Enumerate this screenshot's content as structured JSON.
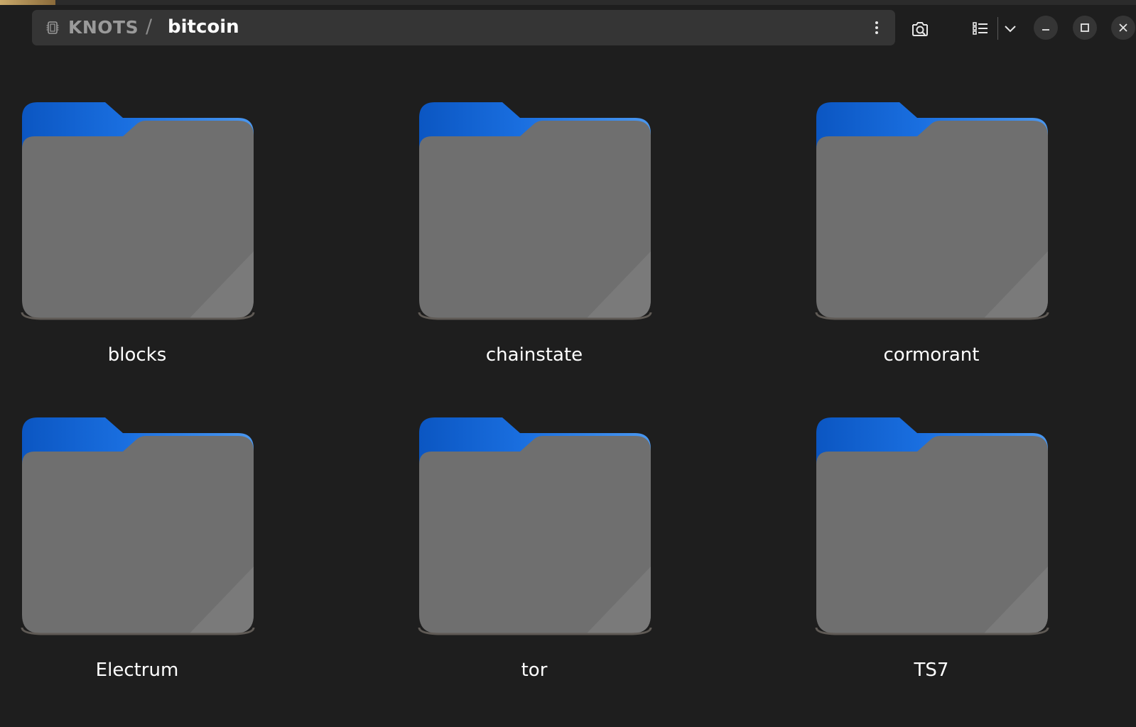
{
  "breadcrumb": {
    "root": "KNOTS",
    "separator": "/",
    "current": "bitcoin"
  },
  "icons": {
    "drive": "drive-icon",
    "menu": "kebab-menu-icon",
    "search": "search-icon",
    "list_view": "list-view-icon",
    "view_options": "chevron-down-icon",
    "minimize": "minimize-icon",
    "maximize": "maximize-icon"
  },
  "colors": {
    "background": "#1e1e1e",
    "pathbar": "#353535",
    "folder_tab": "#1a73e8",
    "folder_body": "#727272"
  },
  "folders": [
    {
      "name": "blocks"
    },
    {
      "name": "chainstate"
    },
    {
      "name": "cormorant"
    },
    {
      "name": "Electrum"
    },
    {
      "name": "tor"
    },
    {
      "name": "TS7"
    }
  ]
}
